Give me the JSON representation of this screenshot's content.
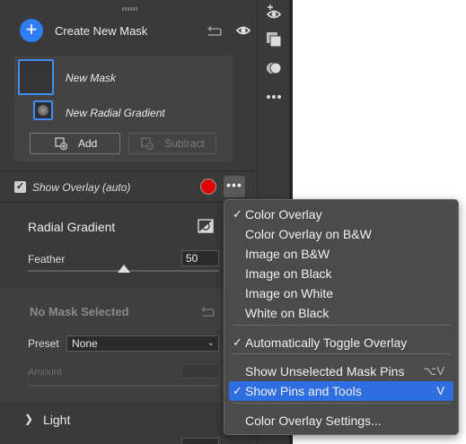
{
  "header": {
    "title": "Create New Mask",
    "add_symbol": "+"
  },
  "mask_list": {
    "mask_name": "New Mask",
    "component_name": "New Radial Gradient",
    "add_label": "Add",
    "subtract_label": "Subtract"
  },
  "overlay": {
    "label": "Show Overlay (auto)",
    "checked": "✓",
    "color": "#e40000",
    "more_label": "•••"
  },
  "radial": {
    "title": "Radial Gradient",
    "feather_label": "Feather",
    "feather_value": "50",
    "feather_fraction": 0.5
  },
  "no_mask": {
    "title": "No Mask Selected",
    "preset_label": "Preset",
    "preset_value": "None",
    "amount_label": "Amount"
  },
  "light": {
    "title": "Light",
    "chevron": "❯"
  },
  "menu": {
    "check_symbol": "✓",
    "items": [
      {
        "label": "Color Overlay",
        "checked": true
      },
      {
        "label": "Color Overlay on B&W",
        "checked": false
      },
      {
        "label": "Image on B&W",
        "checked": false
      },
      {
        "label": "Image on Black",
        "checked": false
      },
      {
        "label": "Image on White",
        "checked": false
      },
      {
        "label": "White on Black",
        "checked": false
      },
      {
        "label": "Automatically Toggle Overlay",
        "checked": true
      },
      {
        "label": "Show Unselected Mask Pins",
        "checked": false,
        "shortcut": "⌥V"
      },
      {
        "label": "Show Pins and Tools",
        "checked": true,
        "shortcut": "V",
        "highlighted": true
      },
      {
        "label": "Color Overlay Settings...",
        "checked": false
      }
    ]
  },
  "colors": {
    "accent": "#2f7df5",
    "highlight": "#2f6ee0",
    "panel": "#3a3a3a"
  },
  "toolstrip": {
    "icons": [
      "add-eye-icon",
      "layers-icon",
      "overlap-circles-icon",
      "more-dots-icon"
    ]
  }
}
